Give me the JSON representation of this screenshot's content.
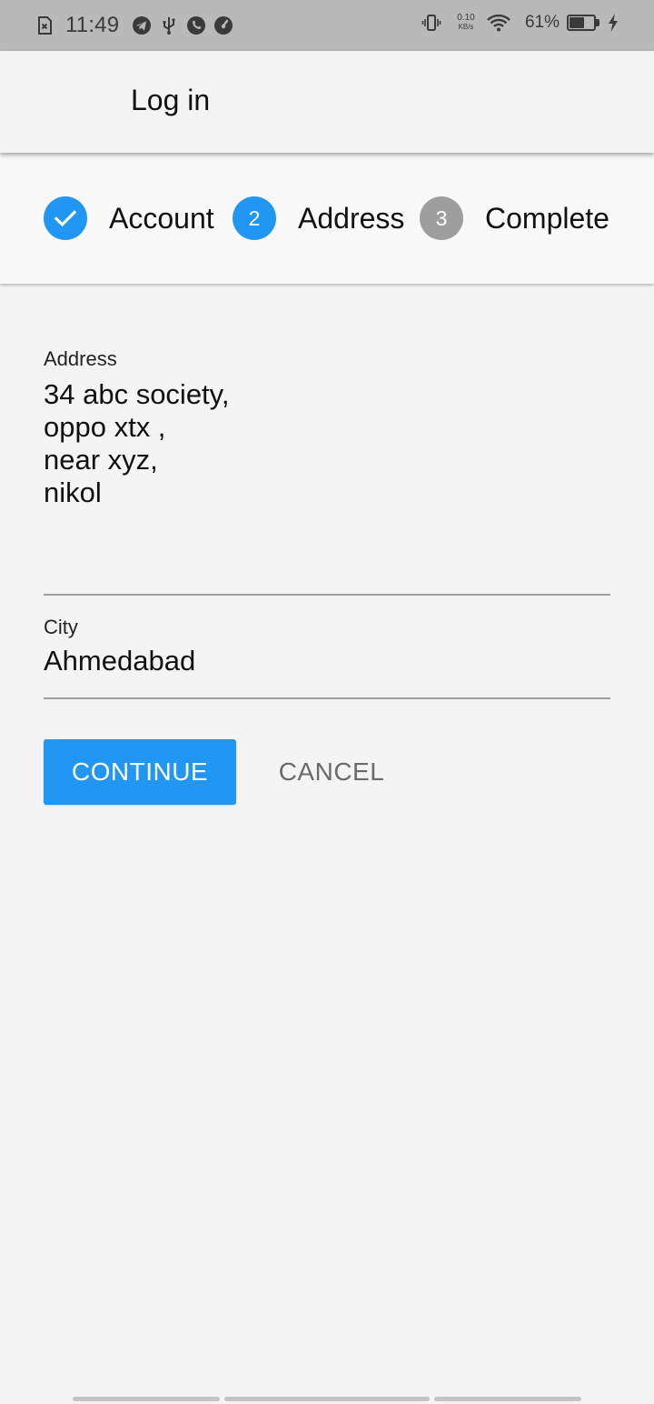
{
  "status_bar": {
    "time": "11:49",
    "network_speed_value": "0.10",
    "network_speed_unit": "KB/s",
    "battery_percent": "61%",
    "battery_level": 0.61,
    "left_icons": [
      "no-sim-icon",
      "telegram-icon",
      "usb-icon",
      "phone-icon",
      "speedometer-icon"
    ],
    "right_icons": [
      "vibrate-icon",
      "wifi-icon",
      "battery-icon",
      "charging-icon"
    ]
  },
  "app_bar": {
    "title": "Log in"
  },
  "stepper": {
    "steps": [
      {
        "label": "Account",
        "number": "1",
        "state": "completed",
        "icon": "check-icon"
      },
      {
        "label": "Address",
        "number": "2",
        "state": "active"
      },
      {
        "label": "Complete",
        "number": "3",
        "state": "inactive"
      }
    ],
    "colors": {
      "active": "#2196f3",
      "inactive": "#9e9e9e"
    }
  },
  "form": {
    "address": {
      "label": "Address",
      "lines": [
        "34 abc society,",
        "oppo xtx ,",
        "near xyz,",
        "nikol"
      ]
    },
    "city": {
      "label": "City",
      "value": "Ahmedabad"
    }
  },
  "actions": {
    "continue_label": "CONTINUE",
    "cancel_label": "CANCEL"
  },
  "colors": {
    "accent": "#2196f3",
    "background": "#f4f4f4",
    "status_bar": "#b9b9b9"
  }
}
